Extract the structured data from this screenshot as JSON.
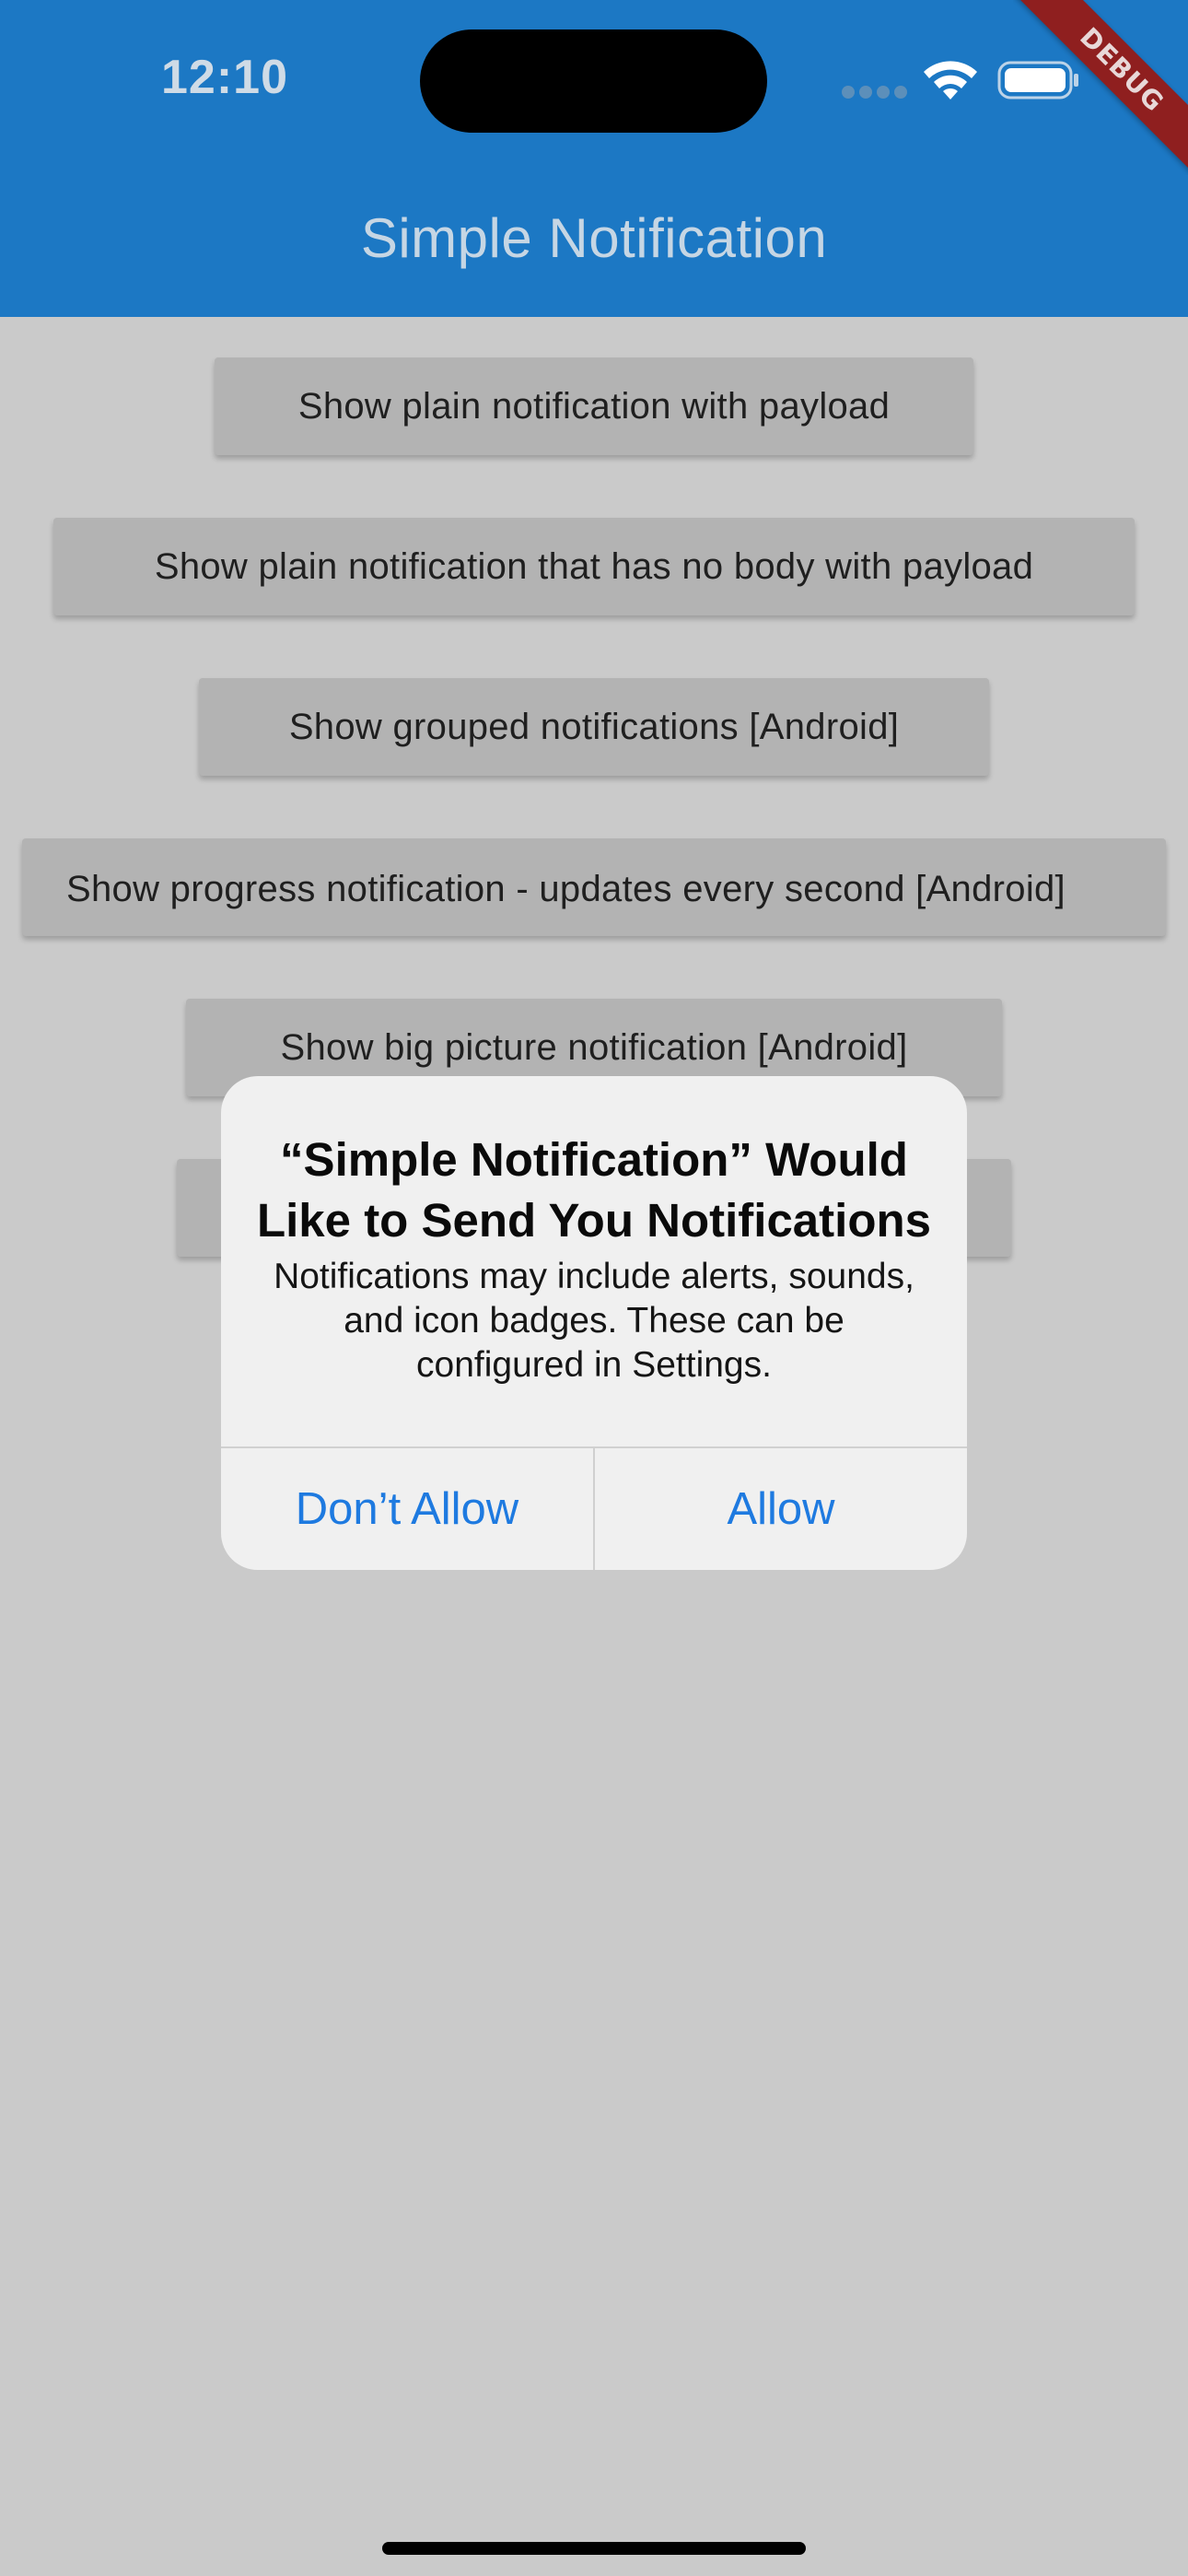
{
  "status_bar": {
    "time": "12:10",
    "icons": [
      "cellular-signal-icon",
      "wifi-icon",
      "battery-icon"
    ]
  },
  "debug_banner": "DEBUG",
  "app_bar": {
    "title": "Simple Notification",
    "color": "#1c78c4"
  },
  "buttons": [
    "Show plain notification with payload",
    "Show plain notification that has no body with payload",
    "Show grouped notifications [Android]",
    "Show progress notification - updates every second [Android]",
    "Show big picture notification [Android]"
  ],
  "dialog": {
    "title": "“Simple Notification” Would Like to Send You Notifications",
    "message": "Notifications may include alerts, sounds, and icon badges. These can be configured in Settings.",
    "deny_label": "Don’t Allow",
    "allow_label": "Allow",
    "action_color": "#1e7ae0"
  }
}
